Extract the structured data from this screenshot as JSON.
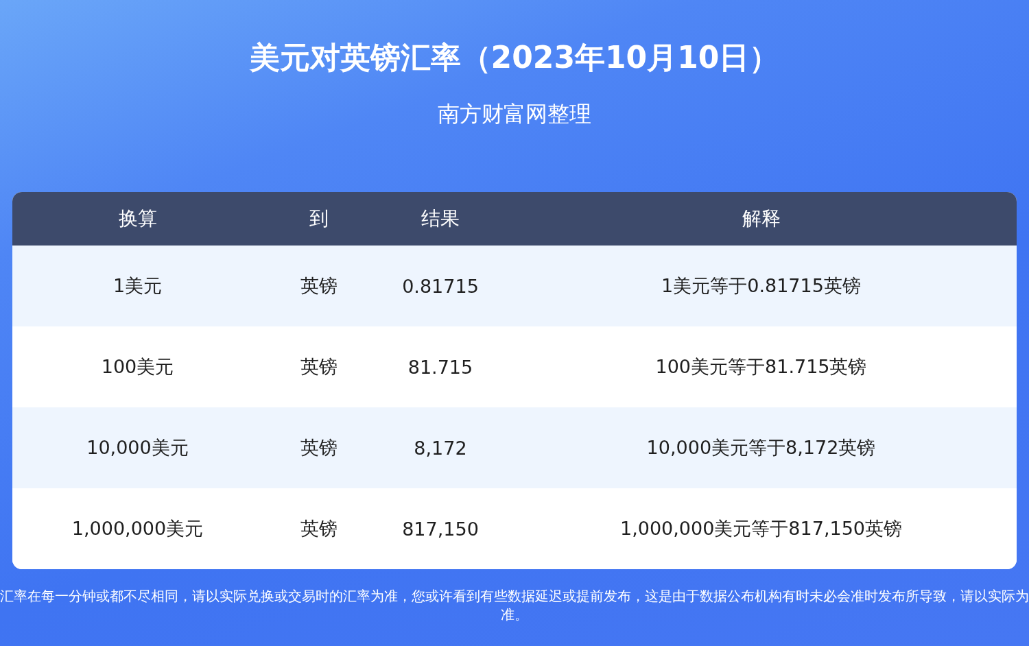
{
  "title": "美元对英镑汇率（2023年10月10日）",
  "subtitle": "南方财富网整理",
  "table": {
    "columns": [
      "换算",
      "到",
      "结果",
      "解释"
    ],
    "rows": [
      {
        "cells": [
          "1美元",
          "英镑",
          "0.81715",
          "1美元等于0.81715英镑"
        ]
      },
      {
        "cells": [
          "100美元",
          "英镑",
          "81.715",
          "100美元等于81.715英镑"
        ]
      },
      {
        "cells": [
          "10,000美元",
          "英镑",
          "8,172",
          "10,000美元等于8,172英镑"
        ]
      },
      {
        "cells": [
          "1,000,000美元",
          "英镑",
          "817,150",
          "1,000,000美元等于817,150英镑"
        ]
      }
    ]
  },
  "footnote": "汇率在每一分钟或都不尽相同，请以实际兑换或交易时的汇率为准，您或许看到有些数据延迟或提前发布，这是由于数据公布机构有时未必会准时发布所导致，请以实际为准。"
}
